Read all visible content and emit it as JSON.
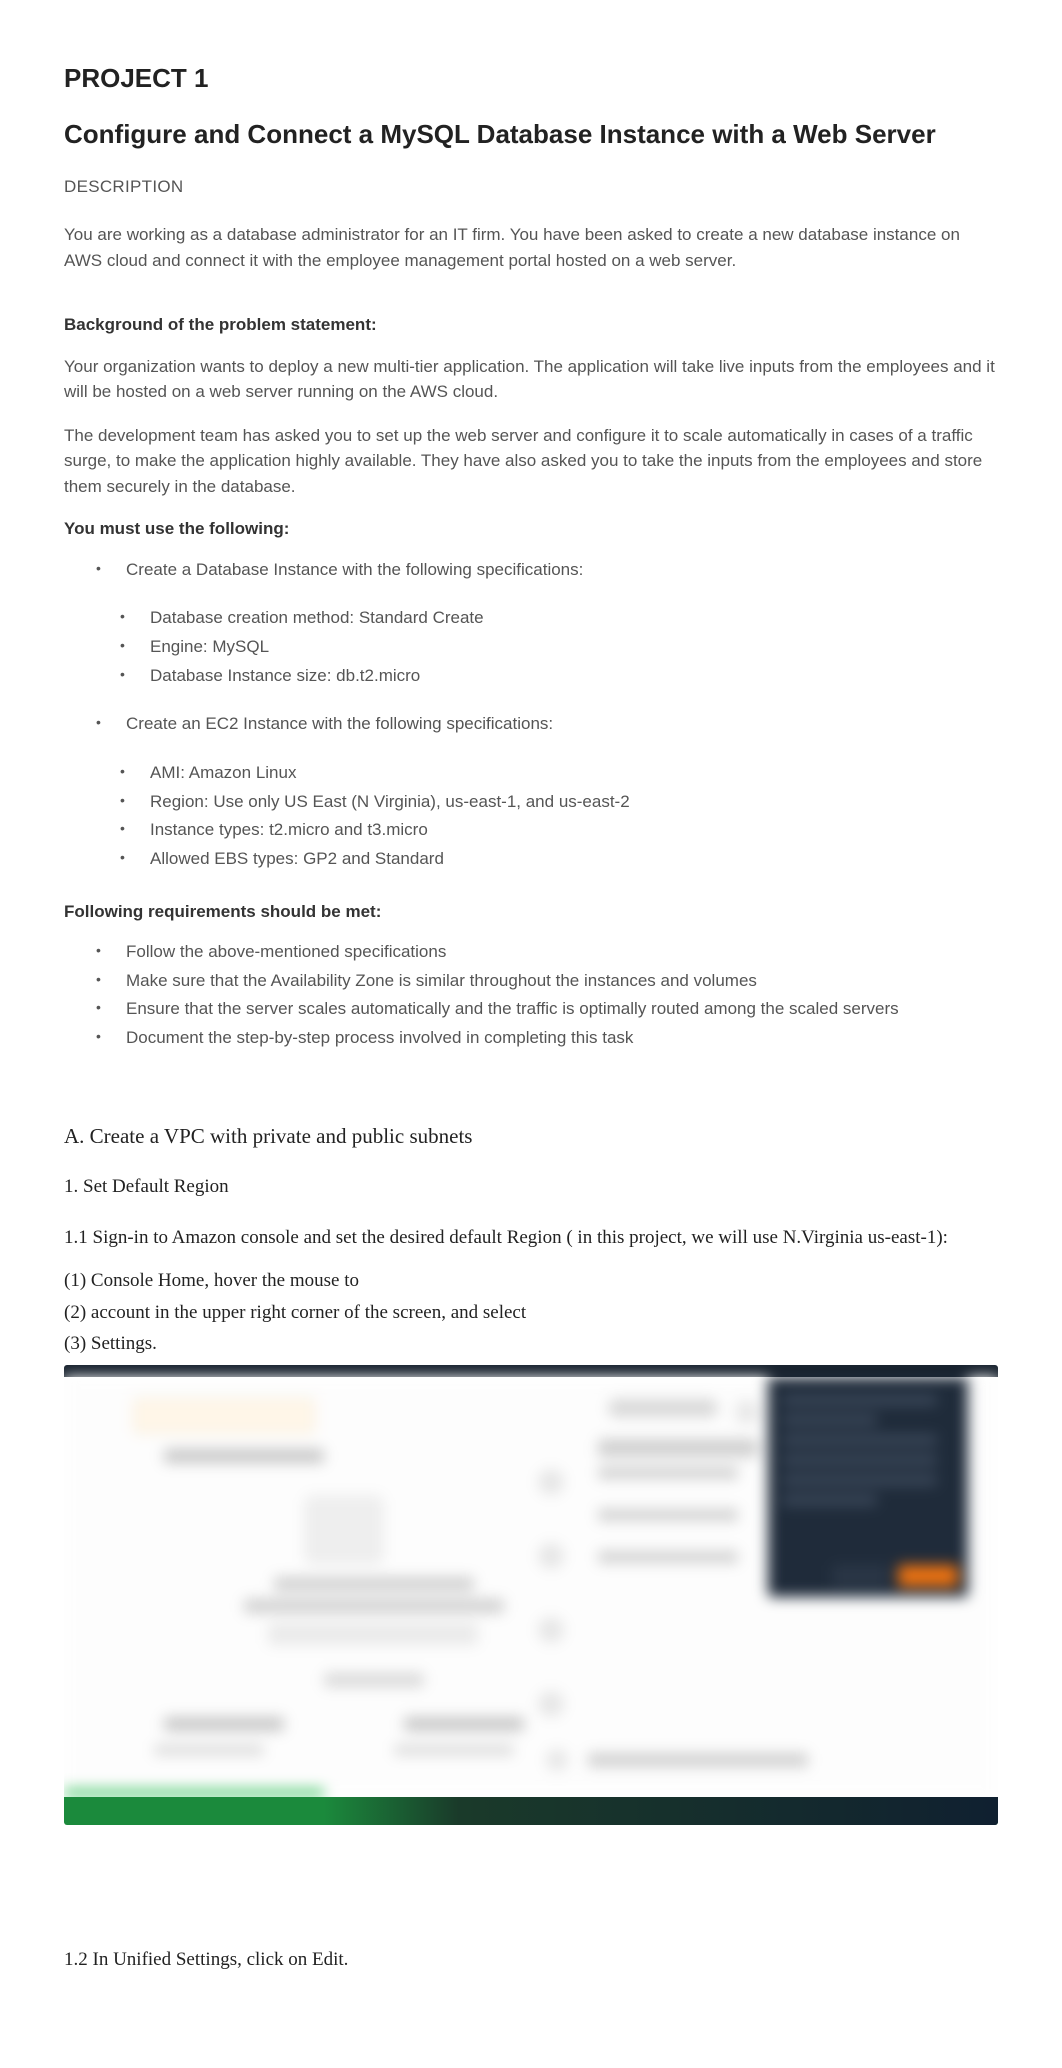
{
  "project_label": "PROJECT 1",
  "title": "Configure and Connect a MySQL Database Instance with a Web Server",
  "description_label": "DESCRIPTION",
  "intro": "You are working as a database administrator for an IT firm. You have been asked to create a new database instance on AWS cloud and connect it with the employee management portal hosted on a web server.",
  "background_heading": "Background of the problem statement:",
  "background_p1": "Your organization wants to deploy a new multi-tier application. The application will take live inputs from the employees and it will be hosted on a web server running on the AWS cloud.",
  "background_p2": "The development team has asked you to set up the web server and configure it to scale automatically in cases of a traffic surge, to make the application highly available. They have also asked you to take the inputs from the employees and store them securely in the database.",
  "must_use_heading": "You must use the following:",
  "db_spec_heading": "Create a Database Instance with the following specifications:",
  "db_specs": [
    "Database creation method: Standard Create",
    "Engine: MySQL",
    "Database Instance size: db.t2.micro"
  ],
  "ec2_spec_heading": "Create an EC2 Instance with the following specifications:",
  "ec2_specs": [
    "AMI: Amazon Linux",
    "Region: Use only US East (N Virginia), us-east-1, and us-east-2",
    "Instance types: t2.micro and t3.micro",
    "Allowed EBS types: GP2 and Standard"
  ],
  "reqs_heading": "Following requirements should be met:",
  "reqs": [
    "Follow the above-mentioned specifications",
    "Make sure that the Availability Zone is similar throughout the instances and volumes",
    "Ensure that the server scales automatically and the traffic is optimally routed among the scaled servers",
    "Document the step-by-step process involved in completing this task"
  ],
  "section_a": "A. Create a VPC with private and public subnets",
  "step_1": "1. Set Default Region",
  "step_1_1": "1.1 Sign-in to Amazon console and set the desired default Region (   in this project, we will use N.Virginia us-east-1):",
  "step_1_1_a": "(1) Console Home, hover the mouse to",
  "step_1_1_b": "(2) account in the upper right corner of the screen, and select",
  "step_1_1_c": "(3) Settings.",
  "step_1_2": "1.2 In Unified Settings, click on Edit."
}
